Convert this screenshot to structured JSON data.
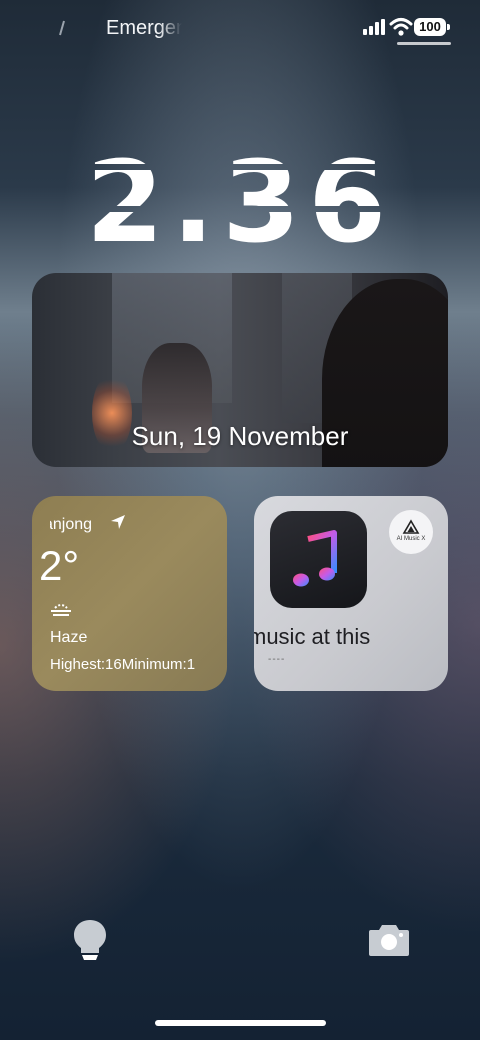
{
  "status_bar": {
    "carrier": "Emergency",
    "battery": "100"
  },
  "clock": {
    "time": "2.36"
  },
  "photo_widget": {
    "date": "Sun, 19 November"
  },
  "weather_widget": {
    "location": "Tanjong",
    "temperature": "2°",
    "condition": "Haze",
    "range": "Highest:16Minimum:1"
  },
  "music_widget": {
    "badge": "AI Music X",
    "title": "music at this",
    "subtitle": "----"
  },
  "colors": {
    "weather_bg": "#9a8a5d",
    "music_bg": "#d8d9de",
    "music_icon_bg": "#1c1d22"
  },
  "icons": {
    "signal": "signal-icon",
    "wifi": "wifi-icon",
    "battery": "battery-icon",
    "location": "location-arrow-icon",
    "haze": "haze-icon",
    "music_note": "music-note-icon",
    "torch": "flashlight-icon",
    "camera": "camera-icon"
  }
}
